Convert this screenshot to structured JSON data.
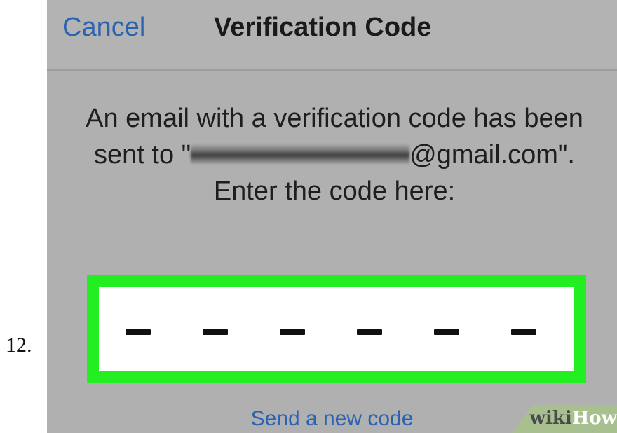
{
  "step": {
    "number": "12."
  },
  "navbar": {
    "cancel_label": "Cancel",
    "title": "Verification Code"
  },
  "message": {
    "line1": "An email with a verification code has been sent to",
    "quote_open": "\"",
    "email_domain_suffix": "@gmail.com\". Enter the code here:"
  },
  "code_input": {
    "digit_count": 6,
    "placeholder_glyph": "—",
    "highlight_color": "#22ee22"
  },
  "resend": {
    "label": "Send a new code"
  },
  "watermark": {
    "part1": "wiki",
    "part2": "How"
  },
  "colors": {
    "link": "#2c63b0",
    "background": "#b0b0b0",
    "text": "#1e1e1e"
  }
}
